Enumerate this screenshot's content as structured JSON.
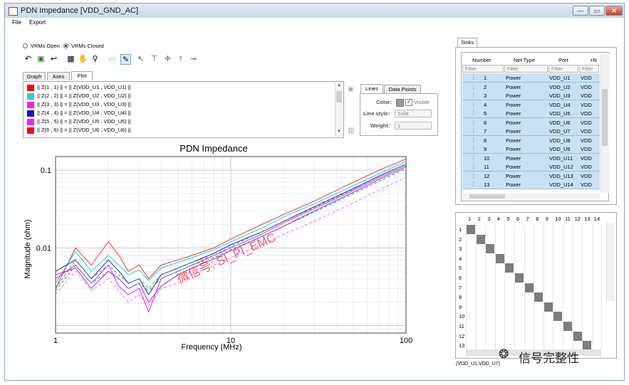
{
  "window": {
    "title": "PDN Impedance [VDD_GND_AC]",
    "buttons": [
      "—",
      "▭",
      "✕"
    ]
  },
  "menu": [
    "File",
    "Export"
  ],
  "vrm_options": [
    {
      "label": "VRMs Open",
      "selected": false
    },
    {
      "label": "VRMs Closed",
      "selected": true
    }
  ],
  "tabs": [
    "Graph",
    "Axes",
    "Plot"
  ],
  "active_tab": "Plot",
  "legend_entries": [
    {
      "label": "|| Z(1 , 1) || = || Z(VDD_U1 , VDD_U1) ||",
      "color": "#ff0000"
    },
    {
      "label": "|| Z(2 , 2) || = || Z(VDD_U2 , VDD_U2) ||",
      "color": "#22d3d3"
    },
    {
      "label": "|| Z(3 , 3) || = || Z(VDD_U3 , VDD_U3) ||",
      "color": "#ee22ee"
    },
    {
      "label": "|| Z(4 , 4) || = || Z(VDD_U4 , VDD_U4) ||",
      "color": "#1111dd"
    },
    {
      "label": "|| Z(5 , 5) || = || Z(VDD_U5 , VDD_U5) ||",
      "color": "#ee22ee"
    },
    {
      "label": "|| Z(6 , 6) || = || Z(VDD_U6 , VDD_U6) ||",
      "color": "#ff0000"
    }
  ],
  "props": {
    "tabs": [
      "Lines",
      "Data Points"
    ],
    "color_label": "Color:",
    "visible_label": "Visible",
    "line_style_label": "Line style:",
    "line_style_value": "Solid",
    "weight_label": "Weight:",
    "weight_value": "1"
  },
  "watermark": "微信号: SI_PI_EMC",
  "chart_data": {
    "type": "line",
    "title": "PDN Impedance",
    "xlabel": "Frequency (MHz)",
    "ylabel": "Magnitude (ohm)",
    "x_scale": "log",
    "y_scale": "log",
    "xlim": [
      1,
      100
    ],
    "ylim": [
      0.0008,
      0.15
    ],
    "x_ticks": [
      "1",
      "10",
      "100"
    ],
    "y_ticks": [
      "0.01",
      "0.1"
    ],
    "grid": true,
    "series": [
      {
        "color": "#ff3333",
        "dash": false,
        "x": [
          1,
          1.3,
          1.6,
          2,
          2.3,
          2.6,
          3,
          3.4,
          4,
          5,
          6,
          8,
          10,
          15,
          20,
          30,
          50,
          70,
          100
        ],
        "y": [
          0.003,
          0.01,
          0.006,
          0.012,
          0.008,
          0.005,
          0.006,
          0.004,
          0.006,
          0.007,
          0.008,
          0.01,
          0.013,
          0.02,
          0.027,
          0.04,
          0.07,
          0.1,
          0.14
        ]
      },
      {
        "color": "#22d3d3",
        "dash": false,
        "x": [
          1,
          1.3,
          1.6,
          2,
          2.3,
          2.6,
          3,
          3.4,
          4,
          5,
          6,
          8,
          10,
          15,
          20,
          30,
          50,
          70,
          100
        ],
        "y": [
          0.0035,
          0.009,
          0.005,
          0.008,
          0.006,
          0.0045,
          0.0052,
          0.0038,
          0.0055,
          0.0065,
          0.0075,
          0.0095,
          0.012,
          0.018,
          0.025,
          0.037,
          0.063,
          0.09,
          0.13
        ]
      },
      {
        "color": "#ee22ee",
        "dash": false,
        "x": [
          1,
          1.3,
          1.6,
          2,
          2.3,
          2.6,
          3,
          3.4,
          4,
          5,
          6,
          8,
          10,
          15,
          20,
          30,
          50,
          70,
          100
        ],
        "y": [
          0.004,
          0.006,
          0.0035,
          0.006,
          0.0032,
          0.0025,
          0.003,
          0.0015,
          0.004,
          0.005,
          0.006,
          0.008,
          0.01,
          0.015,
          0.021,
          0.032,
          0.055,
          0.08,
          0.115
        ]
      },
      {
        "color": "#2222dd",
        "dash": false,
        "x": [
          1,
          1.3,
          1.6,
          2,
          2.3,
          2.6,
          3,
          3.4,
          4,
          5,
          6,
          8,
          10,
          15,
          20,
          30,
          50,
          70,
          100
        ],
        "y": [
          0.005,
          0.007,
          0.004,
          0.007,
          0.005,
          0.0035,
          0.004,
          0.0025,
          0.0045,
          0.0055,
          0.0065,
          0.0085,
          0.011,
          0.016,
          0.022,
          0.034,
          0.058,
          0.084,
          0.12
        ]
      },
      {
        "color": "#ff66ff",
        "dash": true,
        "x": [
          1,
          1.3,
          1.6,
          2,
          2.3,
          2.6,
          3,
          3.4,
          4,
          5,
          6,
          8,
          10,
          15,
          20,
          30,
          50,
          70,
          100
        ],
        "y": [
          0.0025,
          0.005,
          0.0028,
          0.004,
          0.0028,
          0.002,
          0.0025,
          0.0018,
          0.003,
          0.0035,
          0.0045,
          0.006,
          0.0075,
          0.011,
          0.015,
          0.022,
          0.038,
          0.056,
          0.08
        ]
      },
      {
        "color": "#33aa33",
        "dash": true,
        "x": [
          1,
          1.3,
          1.6,
          2,
          2.3,
          2.6,
          3,
          3.4,
          4,
          5,
          6,
          8,
          10,
          15,
          20,
          30,
          50,
          70,
          100
        ],
        "y": [
          0.003,
          0.007,
          0.004,
          0.006,
          0.0045,
          0.0035,
          0.004,
          0.003,
          0.0045,
          0.0055,
          0.0065,
          0.008,
          0.0105,
          0.016,
          0.022,
          0.033,
          0.057,
          0.083,
          0.12
        ]
      },
      {
        "color": "#1199bb",
        "dash": true,
        "x": [
          1,
          1.3,
          1.6,
          2,
          2.3,
          2.6,
          3,
          3.4,
          4,
          5,
          6,
          8,
          10,
          15,
          20,
          30,
          50,
          70,
          100
        ],
        "y": [
          0.0028,
          0.006,
          0.0035,
          0.005,
          0.004,
          0.003,
          0.0035,
          0.0028,
          0.004,
          0.005,
          0.006,
          0.0075,
          0.0095,
          0.014,
          0.019,
          0.029,
          0.05,
          0.072,
          0.105
        ]
      },
      {
        "color": "#9933cc",
        "dash": false,
        "x": [
          1,
          1.3,
          1.6,
          2,
          2.3,
          2.6,
          3,
          3.4,
          4,
          5,
          6,
          8,
          10,
          15,
          20,
          30,
          50,
          70,
          100
        ],
        "y": [
          0.0045,
          0.0055,
          0.003,
          0.005,
          0.004,
          0.003,
          0.0035,
          0.002,
          0.0032,
          0.0045,
          0.0055,
          0.0072,
          0.0092,
          0.014,
          0.019,
          0.03,
          0.052,
          0.076,
          0.11
        ]
      }
    ]
  },
  "sinks": {
    "tab": "Sinks",
    "columns": [
      "Number",
      "Net Type",
      "Port",
      "+N"
    ],
    "filters": [
      "Filter",
      "Filter",
      "Filter",
      "Filter"
    ],
    "rows": [
      {
        "number": "1",
        "net": "Power",
        "port": "VDD_U1",
        "n": "VDD"
      },
      {
        "number": "2",
        "net": "Power",
        "port": "VDD_U2",
        "n": "VDD"
      },
      {
        "number": "3",
        "net": "Power",
        "port": "VDD_U3",
        "n": "VDD"
      },
      {
        "number": "4",
        "net": "Power",
        "port": "VDD_U4",
        "n": "VDD"
      },
      {
        "number": "5",
        "net": "Power",
        "port": "VDD_U5",
        "n": "VDD"
      },
      {
        "number": "6",
        "net": "Power",
        "port": "VDD_U6",
        "n": "VDD"
      },
      {
        "number": "7",
        "net": "Power",
        "port": "VDD_U7",
        "n": "VDD"
      },
      {
        "number": "8",
        "net": "Power",
        "port": "VDD_U8",
        "n": "VDD"
      },
      {
        "number": "9",
        "net": "Power",
        "port": "VDD_U9",
        "n": "VDD"
      },
      {
        "number": "10",
        "net": "Power",
        "port": "VDD_U11",
        "n": "VDD"
      },
      {
        "number": "11",
        "net": "Power",
        "port": "VDD_U12",
        "n": "VDD"
      },
      {
        "number": "12",
        "net": "Power",
        "port": "VDD_U13",
        "n": "VDD"
      },
      {
        "number": "13",
        "net": "Power",
        "port": "VDD_U14",
        "n": "VDD"
      }
    ]
  },
  "matrix": {
    "col_labels": [
      "1",
      "2",
      "3",
      "4",
      "5",
      "6",
      "7",
      "8",
      "9",
      "10",
      "11",
      "12",
      "13",
      "14"
    ],
    "row_labels": [
      "1",
      "2",
      "3",
      "4",
      "5",
      "6",
      "7",
      "8",
      "9",
      "10",
      "11",
      "12",
      "13"
    ],
    "status": "(VDD_U1,VDD_U7)"
  },
  "watermark_logo": "信号完整性"
}
